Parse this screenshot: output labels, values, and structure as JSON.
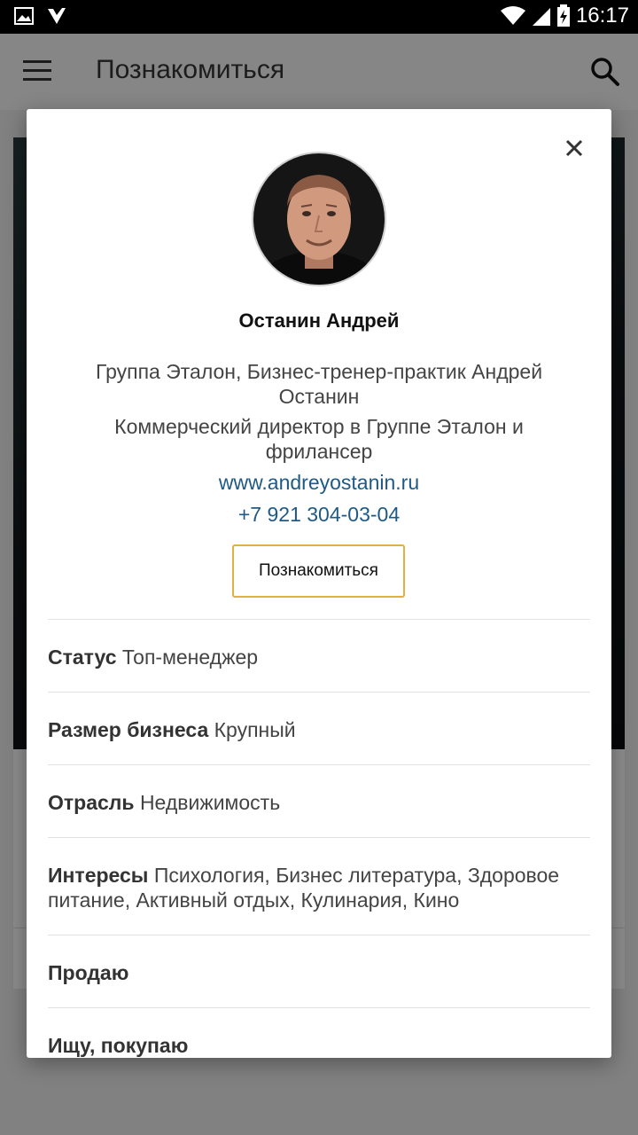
{
  "status_bar": {
    "time": "16:17",
    "icons": [
      "image-icon",
      "check-icon",
      "wifi-icon",
      "signal-icon",
      "battery-charging-icon"
    ]
  },
  "app_bar": {
    "title": "Познакомиться",
    "menu_icon": "menu-icon",
    "search_icon": "search-icon"
  },
  "profile": {
    "name": "Останин Андрей",
    "company": "Группа Эталон, Бизнес-тренер-практик Андрей Останин",
    "position": "Коммерческий директор в Группе Эталон и фрилансер",
    "website": "www.andreyostanin.ru",
    "phone": "+7 921 304-03-04",
    "action_label": "Познакомиться",
    "close_icon": "close-icon"
  },
  "fields": [
    {
      "label": "Статус",
      "value": "Топ-менеджер"
    },
    {
      "label": "Размер бизнеса",
      "value": "Крупный"
    },
    {
      "label": "Отрасль",
      "value": "Недвижимость"
    },
    {
      "label": "Интересы",
      "value": "Психология, Бизнес литература, Здоровое питание, Активный отдых, Кулинария, Кино"
    },
    {
      "label": "Продаю",
      "value": ""
    },
    {
      "label": "Ищу, покупаю",
      "value": ""
    }
  ],
  "colors": {
    "link": "#1e5a85",
    "button_border": "#e0b040",
    "status_bar": "#000000"
  }
}
